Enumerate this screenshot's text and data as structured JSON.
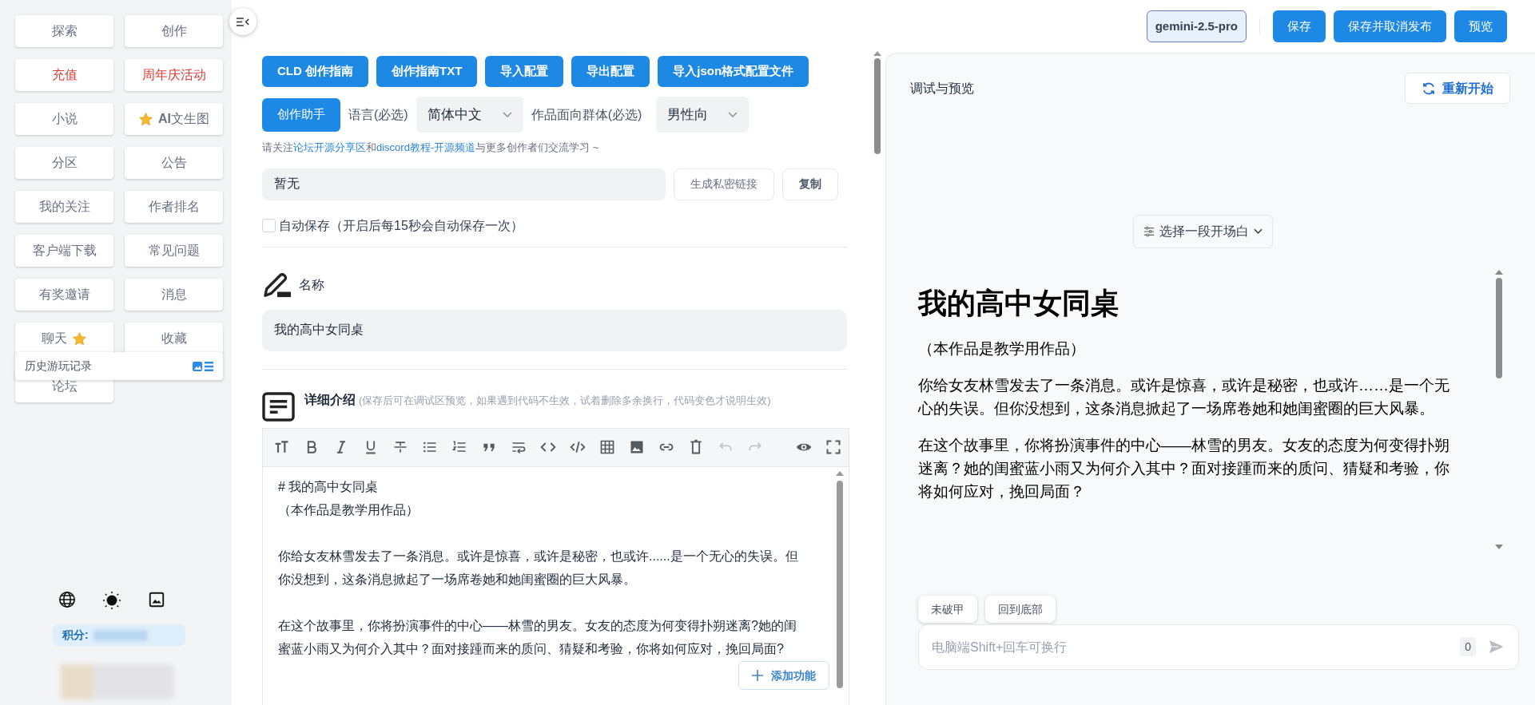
{
  "sidebar": {
    "items": [
      {
        "label": "探索",
        "kind": "normal"
      },
      {
        "label": "创作",
        "kind": "normal"
      },
      {
        "label": "充值",
        "kind": "promo"
      },
      {
        "label": "周年庆活动",
        "kind": "promo"
      },
      {
        "label": "小说",
        "kind": "normal"
      },
      {
        "label": "**AI**文生图",
        "kind": "normal",
        "leading_star": true
      },
      {
        "label": "分区",
        "kind": "normal"
      },
      {
        "label": "公告",
        "kind": "normal"
      },
      {
        "label": "我的关注",
        "kind": "normal"
      },
      {
        "label": "作者排名",
        "kind": "normal"
      },
      {
        "label": "客户端下载",
        "kind": "normal"
      },
      {
        "label": "常见问题",
        "kind": "normal"
      },
      {
        "label": "有奖邀请",
        "kind": "normal"
      },
      {
        "label": "消息",
        "kind": "normal"
      },
      {
        "label": "聊天",
        "kind": "normal",
        "trailing_star": true
      },
      {
        "label": "收藏",
        "kind": "normal"
      },
      {
        "label": "论坛",
        "kind": "normal"
      }
    ],
    "history_popup": {
      "label": "历史游玩记录"
    },
    "points": {
      "label": "积分:"
    }
  },
  "toolbar_top": {
    "model": "gemini-2.5-pro",
    "buttons": [
      "保存",
      "保存并取消发布",
      "预览"
    ]
  },
  "editor_panel": {
    "action_buttons": [
      "CLD 创作指南",
      "创作指南TXT",
      "导入配置",
      "导出配置",
      "导入json格式配置文件"
    ],
    "assistant_button": "创作助手",
    "language": {
      "label": "语言(必选)",
      "value": "简体中文"
    },
    "audience": {
      "label": "作品面向群体(必选)",
      "value": "男性向"
    },
    "community_note": [
      {
        "text": "请关注",
        "kind": "text"
      },
      {
        "text": "论坛开源分享区",
        "kind": "link"
      },
      {
        "text": "和",
        "kind": "text"
      },
      {
        "text": "discord教程-开源频道",
        "kind": "link"
      },
      {
        "text": "与更多创作者们交流学习 ~",
        "kind": "text"
      }
    ],
    "private_link": {
      "value": "暂无",
      "generate_button": "生成私密链接",
      "copy_button": "复制"
    },
    "autosave": {
      "label": "自动保存（开启后每15秒会自动保存一次）",
      "checked": false
    },
    "name": {
      "label": "名称",
      "value": "我的高中女同桌"
    },
    "description": {
      "label": "详细介绍",
      "hint": "(保存后可在调试区预览，如果遇到代码不生效，试着删除多余换行，代码变色才说明生效)",
      "toolbar": [
        {
          "kind": "heading",
          "disabled": false
        },
        {
          "kind": "bold",
          "disabled": false
        },
        {
          "kind": "italic",
          "disabled": false
        },
        {
          "kind": "underline",
          "disabled": false
        },
        {
          "kind": "strike",
          "disabled": false
        },
        {
          "kind": "bullets",
          "disabled": false
        },
        {
          "kind": "numbers",
          "disabled": false
        },
        {
          "kind": "quote",
          "disabled": false
        },
        {
          "kind": "wrap",
          "disabled": false
        },
        {
          "kind": "code",
          "disabled": false
        },
        {
          "kind": "codeblock",
          "disabled": false
        },
        {
          "kind": "table",
          "disabled": false
        },
        {
          "kind": "image",
          "disabled": false
        },
        {
          "kind": "link",
          "disabled": false
        },
        {
          "kind": "trash",
          "disabled": false
        },
        {
          "kind": "undo",
          "disabled": true
        },
        {
          "kind": "redo",
          "disabled": true
        },
        {
          "kind": "preview",
          "disabled": false
        },
        {
          "kind": "fullscreen",
          "disabled": false
        }
      ],
      "content": [
        [
          "# 我的高中女同桌",
          "（本作品是教学用作品）"
        ],
        [
          "你给女友林雪发去了一条消息。或许是惊喜，或许是秘密，也或许......是一个无心的失误。但你没想到，这条消息掀起了一场席卷她和她闺蜜圈的巨大风暴。"
        ],
        [
          "在这个故事里，你将扮演事件的中心——林雪的男友。女友的态度为何变得扑朔迷离?她的闺蜜蓝小雨又为何介入其中？面对接踵而来的质问、猜疑和考验，你将如何应对，挽回局面?"
        ]
      ]
    },
    "add_feature_button": "添加功能"
  },
  "preview_panel": {
    "title": "调试与预览",
    "restart_button": "重新开始",
    "opening_select": "选择一段开场白",
    "heading": "我的高中女同桌",
    "paragraphs": [
      "（本作品是教学用作品）",
      "你给女友林雪发去了一条消息。或许是惊喜，或许是秘密，也或许……是一个无心的失误。但你没想到，这条消息掀起了一场席卷她和她闺蜜圈的巨大风暴。",
      "在这个故事里，你将扮演事件的中心——林雪的男友。女友的态度为何变得扑朔迷离？她的闺蜜蓝小雨又为何介入其中？面对接踵而来的质问、猜疑和考验，你将如何应对，挽回局面？"
    ],
    "chips": [
      "未破甲",
      "回到底部"
    ],
    "input": {
      "placeholder": "电脑端Shift+回车可换行",
      "counter": "0"
    }
  }
}
